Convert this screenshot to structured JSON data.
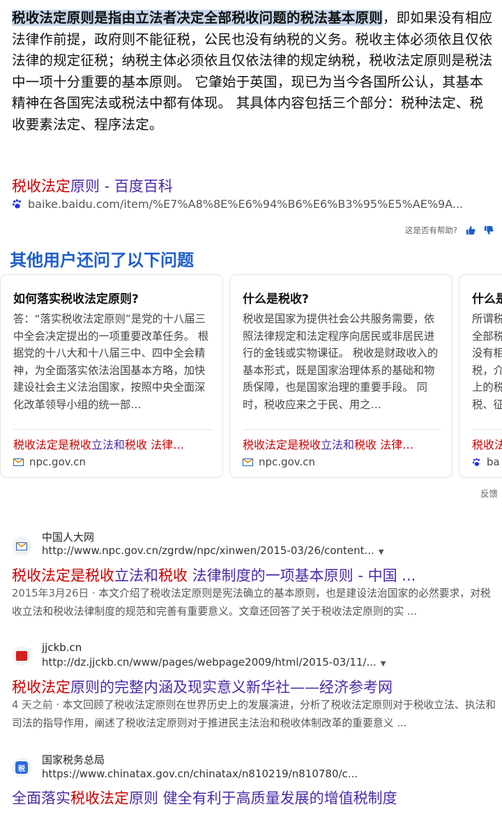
{
  "answer": {
    "highlight": "税收法定原则是指由立法者决定全部税收问题的税法基本原则",
    "body": "，即如果没有相应法律作前提，政府则不能征税，公民也没有纳税的义务。税收主体必须依且仅依法律的规定征税；纳税主体必须依且仅依法律的规定纳税，税收法定原则是税法中一项十分重要的基本原则。 它肇始于英国，现已为当今各国所公认，其基本精神在各国宪法或税法中都有体现。 其具体内容包括三个部分：税种法定、税收要素法定、程序法定。"
  },
  "source": {
    "title_red": "税收法定",
    "title_rest": "原则 - 百度百科",
    "url": "baike.baidu.com/item/%E7%A8%8E%E6%94%B6%E6%B3%95%E5%AE%9A..."
  },
  "helpful": {
    "label": "这是否有帮助?"
  },
  "paa": {
    "title": "其他用户还问了以下问题",
    "cards": [
      {
        "question": "如何落实税收法定原则?",
        "answer": "答：“落实税收法定原则”是党的十八届三中全会决定提出的一项重要改革任务。 根据党的十八大和十八届三中、四中全会精神，为全面落实依法治国基本方略，加快建设社会主义法治国家，按照中央全面深化改革领导小组的统一部…",
        "link_red": "税收法定是税收",
        "link_purple": "立法和",
        "link_red2": "税收",
        "link_rest": " 法律…",
        "domain": "npc.gov.cn"
      },
      {
        "question": "什么是税收?",
        "answer": "税收是国家为提供社会公共服务需要，依照法律规定和法定程序向居民或非居民进行的金钱或实物课征。 税收是财政收入的基本形式，既是国家治理体系的基础和物质保障，也是国家治理的重要手段。 同时，税收应来之于民、用之…",
        "link_red": "税收法定是税收",
        "link_purple": "立法和",
        "link_red2": "税收",
        "link_rest": " 法律…",
        "domain": "npc.gov.cn"
      },
      {
        "question": "什么是",
        "answer": "所谓税 全部税 没有相 税，介 上的税 税、征",
        "link_red": "税收法",
        "domain": "ba"
      }
    ]
  },
  "feedback": "反馈",
  "results": [
    {
      "site": "中国人大网",
      "url": "http://www.npc.gov.cn/zgrdw/npc/xinwen/2015-03/26/content...",
      "title_red": "税收法定是税收",
      "title_purple": "立法和",
      "title_red2": "税收",
      "title_rest": " 法律制度的一项基本原则 - 中国 ...",
      "date": "2015年3月26日",
      "snippet": " · 本文介绍了税收法定原则是宪法确立的基本原则，也是建设法治国家的必然要求，对税收立法和税收法律制度的规范和完善有重要意义。文章还回答了关于税收法定原则的实 ..."
    },
    {
      "site": "jjckb.cn",
      "url": "http://dz.jjckb.cn/www/pages/webpage2009/html/2015-03/11/...",
      "title_red": "税收法定",
      "title_rest": "原则的完整内涵及现实意义新华社——经济参考网",
      "date": "4 天之前",
      "snippet": " · 本文回顾了税收法定原则在世界历史上的发展演进，分析了税收法定原则对于税收立法、执法和司法的指导作用，阐述了税收法定原则对于推进民主法治和税收体制改革的重要意义 ..."
    },
    {
      "site": "国家税务总局",
      "url": "https://www.chinatax.gov.cn/chinatax/n810219/n810780/c...",
      "title_pre": "全面落实",
      "title_red": "税收法定",
      "title_rest": "原则 健全有利于高质量发展的增值税制度"
    }
  ],
  "colors": {
    "link_purple": "#4b2aa5",
    "link_red": "#c80000",
    "paa_blue": "#1e5ec8",
    "highlight": "#c8d6ea"
  }
}
